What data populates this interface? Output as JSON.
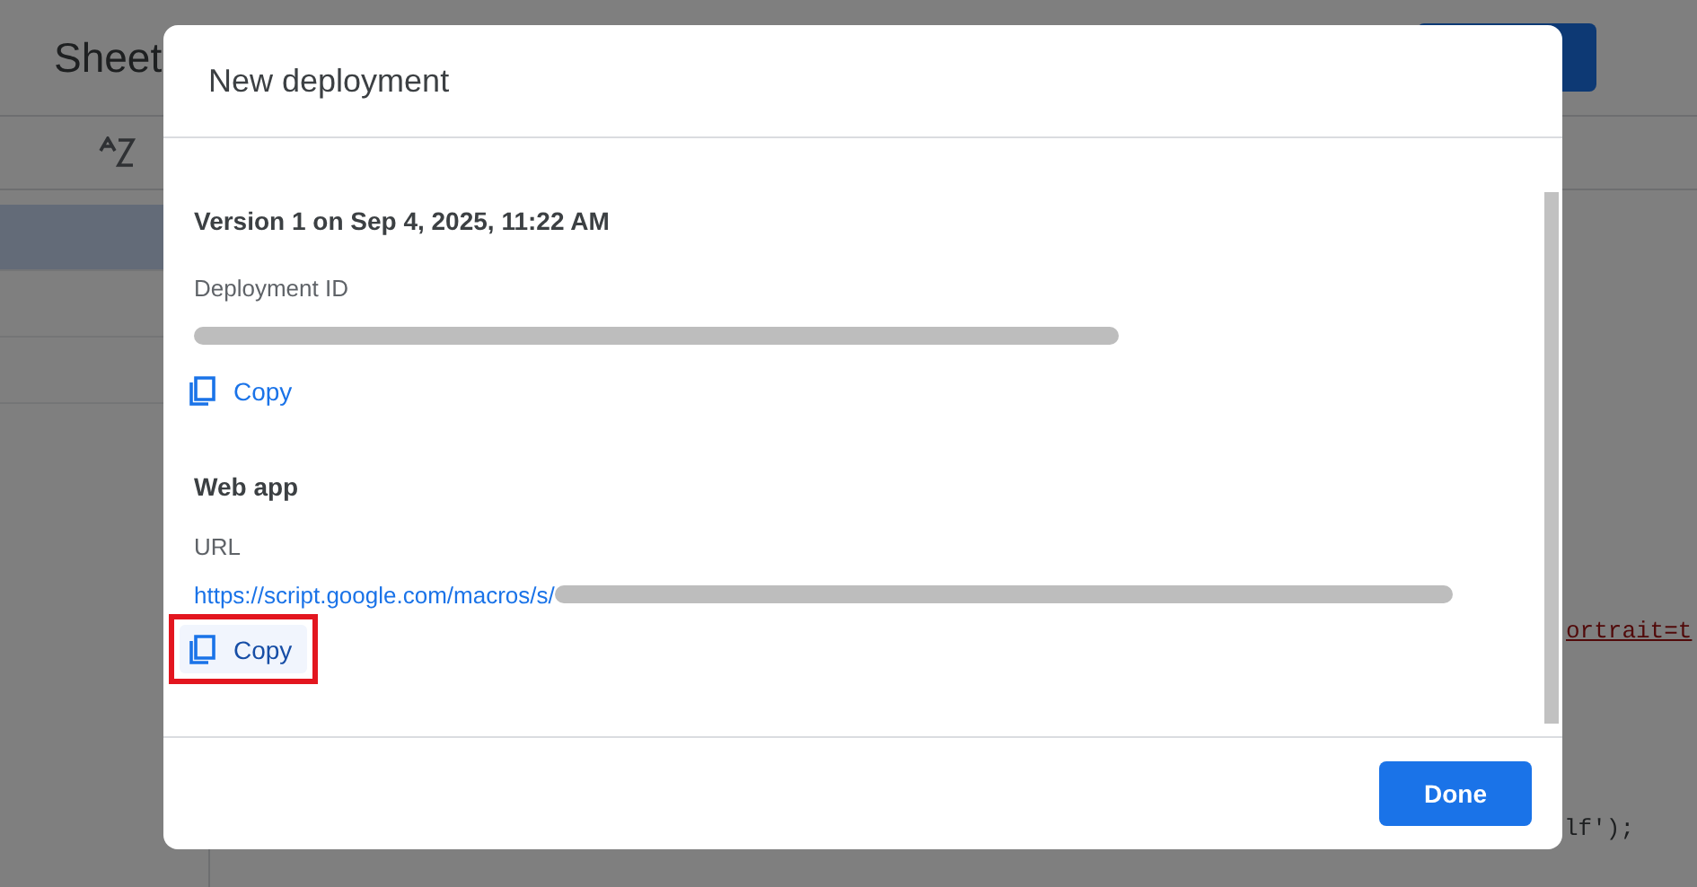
{
  "background": {
    "app_title": "Sheet",
    "code_fragments": [
      {
        "text": "ortrait=t",
        "kind": "error"
      },
      {
        "text": "lf');",
        "kind": "plain"
      }
    ],
    "sidebar_items": [
      {
        "selected": true
      },
      {
        "selected": false
      },
      {
        "selected": false
      }
    ]
  },
  "dialog": {
    "title": "New deployment",
    "version_heading": "Version 1 on Sep 4, 2025, 11:22 AM",
    "sections": [
      {
        "label": "Deployment ID",
        "kind": "id",
        "copy": {
          "label": "Copy",
          "highlighted": false
        }
      },
      {
        "heading": "Web app",
        "label": "URL",
        "kind": "link",
        "value_prefix": "https://script.google.com/macros/s/",
        "copy": {
          "label": "Copy",
          "highlighted": true
        }
      }
    ],
    "done_button": "Done"
  }
}
